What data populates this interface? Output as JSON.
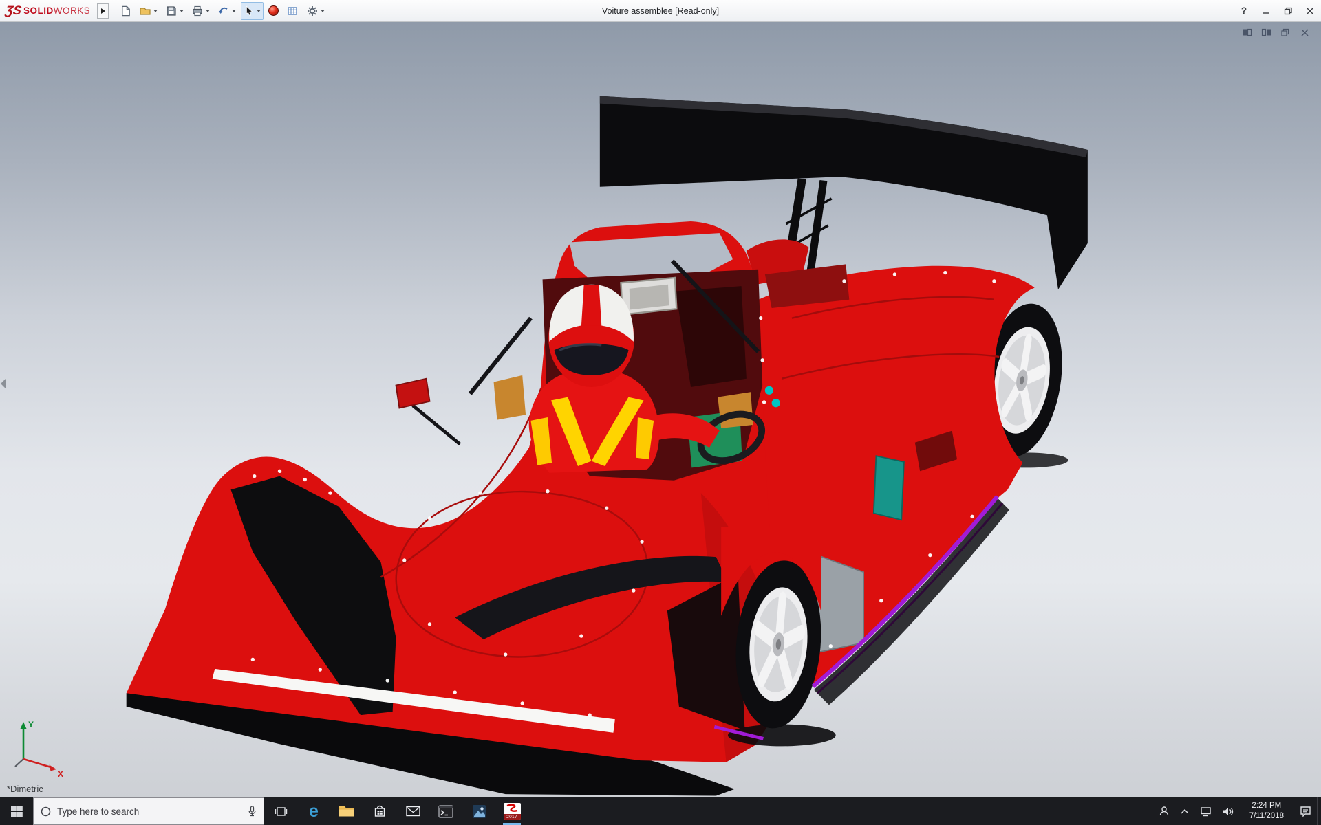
{
  "colors": {
    "accent_red": "#c00d1e",
    "car_red": "#dc0f0e",
    "purple_trim": "#a21bd6",
    "teal_accent": "#17958a",
    "harness_yellow": "#ffd400",
    "taskbar_bg": "#1b1c20",
    "viewport_gradient_top": "#8f9aa9",
    "viewport_gradient_bottom": "#cdd0d5"
  },
  "title_bar": {
    "brand_mark": "ƷS",
    "brand_solid": "SOLID",
    "brand_works": "WORKS",
    "title": "Voiture assemblee [Read-only]",
    "help_glyph": "?",
    "toolbar_icons": [
      "new-document",
      "open",
      "save",
      "print",
      "undo",
      "select",
      "appearance-sphere",
      "design-table",
      "options-gear"
    ]
  },
  "viewport": {
    "view_orientation_label": "*Dimetric",
    "triad_x_label": "X",
    "triad_y_label": "Y",
    "scene_subject": "Red prototype race car assembly with helmeted driver, black rear wing, white five-spoke wheels, purple lower trim and teal cockpit accents"
  },
  "taskbar": {
    "search_placeholder": "Type here to search",
    "time": "2:24 PM",
    "date": "7/11/2018",
    "edge_glyph": "e",
    "solidworks_year": "2017",
    "apps": [
      "start",
      "search",
      "task-view",
      "edge",
      "file-explorer",
      "store",
      "mail",
      "command-prompt",
      "photos",
      "solidworks-2017"
    ]
  }
}
